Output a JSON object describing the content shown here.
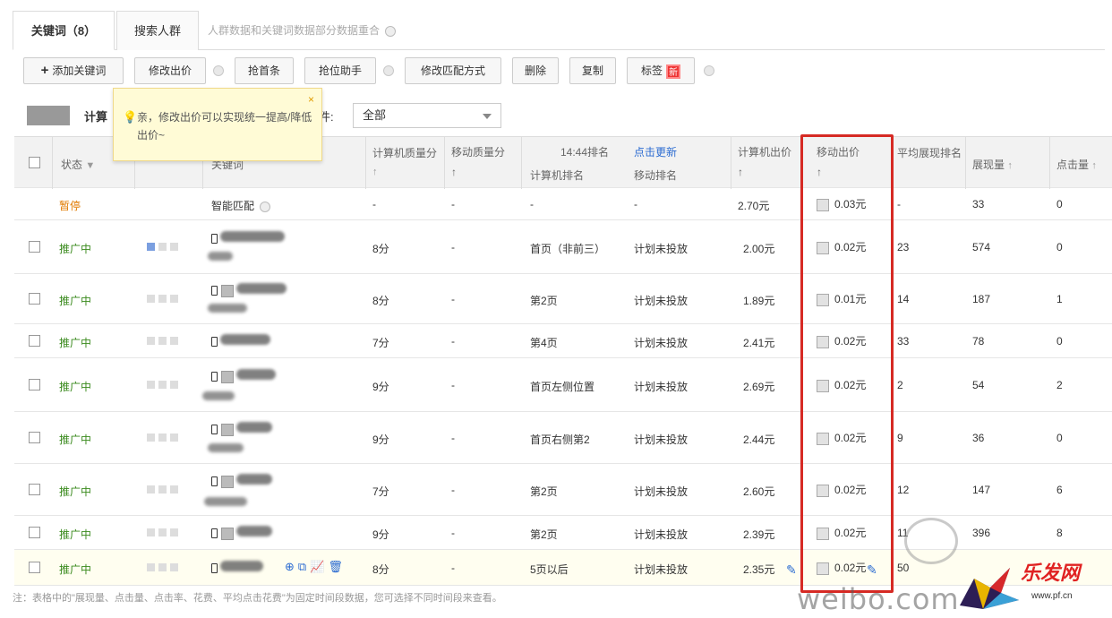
{
  "tabs": {
    "active": "关键词（8）",
    "second": "搜索人群",
    "note": "人群数据和关键词数据部分数据重合"
  },
  "toolbar": {
    "add_keyword": "添加关键词",
    "modify_bid": "修改出价",
    "grab_first": "抢首条",
    "rank_helper": "抢位助手",
    "modify_match": "修改匹配方式",
    "delete": "删除",
    "copy": "复制",
    "tag": "标签",
    "new_badge": "新"
  },
  "filter": {
    "label": "计算",
    "label2": "件:",
    "select_value": "全部"
  },
  "tooltip": {
    "text": "亲，修改出价可以实现统一提高/降低出价~",
    "close": "×"
  },
  "table": {
    "headers": {
      "status": "状态",
      "keyword": "关键词",
      "pc_quality": "计算机质量分",
      "mobile_quality": "移动质量分",
      "rank_time": "14:44排名",
      "refresh": "点击更新",
      "pc_rank": "计算机排名",
      "mobile_rank": "移动排名",
      "pc_bid": "计算机出价",
      "mobile_bid": "移动出价",
      "avg_rank": "平均展现排名",
      "impressions": "展现量",
      "clicks": "点击量"
    },
    "rows": [
      {
        "status": "暂停",
        "type": "pause",
        "keyword": "智能匹配",
        "pc_quality": "-",
        "mobile_quality": "-",
        "pc_rank": "-",
        "mobile_rank": "-",
        "pc_bid": "2.70元",
        "mobile_bid": "0.03元",
        "avg_rank": "-",
        "impressions": "33",
        "clicks": "0"
      },
      {
        "status": "推广中",
        "type": "on",
        "keyword": "",
        "pc_quality": "8分",
        "mobile_quality": "-",
        "pc_rank": "首页（非前三）",
        "mobile_rank": "计划未投放",
        "pc_bid": "2.00元",
        "mobile_bid": "0.02元",
        "avg_rank": "23",
        "impressions": "574",
        "clicks": "0"
      },
      {
        "status": "推广中",
        "type": "on",
        "keyword": "",
        "pc_quality": "8分",
        "mobile_quality": "-",
        "pc_rank": "第2页",
        "mobile_rank": "计划未投放",
        "pc_bid": "1.89元",
        "mobile_bid": "0.01元",
        "avg_rank": "14",
        "impressions": "187",
        "clicks": "1"
      },
      {
        "status": "推广中",
        "type": "on",
        "keyword": "",
        "pc_quality": "7分",
        "mobile_quality": "-",
        "pc_rank": "第4页",
        "mobile_rank": "计划未投放",
        "pc_bid": "2.41元",
        "mobile_bid": "0.02元",
        "avg_rank": "33",
        "impressions": "78",
        "clicks": "0"
      },
      {
        "status": "推广中",
        "type": "on",
        "keyword": "",
        "pc_quality": "9分",
        "mobile_quality": "-",
        "pc_rank": "首页左侧位置",
        "mobile_rank": "计划未投放",
        "pc_bid": "2.69元",
        "mobile_bid": "0.02元",
        "avg_rank": "2",
        "impressions": "54",
        "clicks": "2"
      },
      {
        "status": "推广中",
        "type": "on",
        "keyword": "",
        "pc_quality": "9分",
        "mobile_quality": "-",
        "pc_rank": "首页右侧第2",
        "mobile_rank": "计划未投放",
        "pc_bid": "2.44元",
        "mobile_bid": "0.02元",
        "avg_rank": "9",
        "impressions": "36",
        "clicks": "0"
      },
      {
        "status": "推广中",
        "type": "on",
        "keyword": "",
        "pc_quality": "7分",
        "mobile_quality": "-",
        "pc_rank": "第2页",
        "mobile_rank": "计划未投放",
        "pc_bid": "2.60元",
        "mobile_bid": "0.02元",
        "avg_rank": "12",
        "impressions": "147",
        "clicks": "6"
      },
      {
        "status": "推广中",
        "type": "on",
        "keyword": "",
        "pc_quality": "9分",
        "mobile_quality": "-",
        "pc_rank": "第2页",
        "mobile_rank": "计划未投放",
        "pc_bid": "2.39元",
        "mobile_bid": "0.02元",
        "avg_rank": "11",
        "impressions": "396",
        "clicks": "8"
      },
      {
        "status": "推广中",
        "type": "on",
        "keyword": "",
        "pc_quality": "8分",
        "mobile_quality": "-",
        "pc_rank": "5页以后",
        "mobile_rank": "计划未投放",
        "pc_bid": "2.35元",
        "mobile_bid": "0.02元",
        "avg_rank": "50",
        "impressions": "",
        "clicks": ""
      }
    ]
  },
  "footnote": "注：表格中的\"展现量、点击量、点击率、花费、平均点击花费\"为固定时间段数据，您可选择不同时间段来查看。",
  "watermark": {
    "weibo": "weibo.com",
    "brand": "乐发网",
    "url": "www.pf.cn"
  },
  "colors": {
    "highlight_box": "#d62a24",
    "status_on": "#3a8a1d",
    "status_pause": "#e07a00",
    "tooltip_bg": "#fffbd6"
  }
}
